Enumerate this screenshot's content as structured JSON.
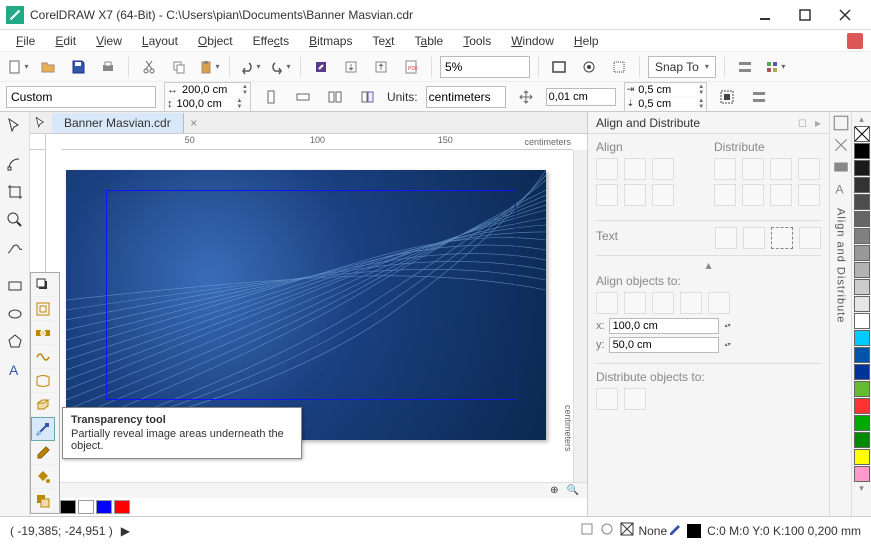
{
  "title": "CorelDRAW X7 (64-Bit) - C:\\Users\\pian\\Documents\\Banner Masvian.cdr",
  "menu": [
    "File",
    "Edit",
    "View",
    "Layout",
    "Object",
    "Effects",
    "Bitmaps",
    "Text",
    "Table",
    "Tools",
    "Window",
    "Help"
  ],
  "zoom_level": "5%",
  "snap_label": "Snap To",
  "preset": "Custom",
  "width": "200,0 cm",
  "height": "100,0 cm",
  "units_label": "Units:",
  "units": "centimeters",
  "nudge": "0,01 cm",
  "dup_x": "0,5 cm",
  "dup_y": "0,5 cm",
  "tab_name": "Banner Masvian.cdr",
  "ruler_unit": "centimeters",
  "ruler_ticks": [
    "50",
    "100",
    "150"
  ],
  "tooltip": {
    "title": "Transparency tool",
    "body": "Partially reveal image areas underneath the object."
  },
  "docker": {
    "title": "Align and Distribute",
    "sect_align": "Align",
    "sect_dist": "Distribute",
    "sect_text": "Text",
    "sect_alignto": "Align objects to:",
    "sect_distto": "Distribute objects to:",
    "x_label": "x:",
    "y_label": "y:",
    "x_val": "100,0 cm",
    "y_val": "50,0 cm",
    "tab_label": "Align and Distribute"
  },
  "palette": [
    "transparent",
    "#000",
    "#111",
    "#222",
    "#333",
    "#444",
    "#555",
    "#666",
    "#777",
    "#888",
    "#999",
    "#aaa",
    "#ccc",
    "#3af",
    "#05f",
    "#f80",
    "#f33",
    "#0a0",
    "#090",
    "#ff0",
    "#f0c"
  ],
  "bottom_colors": [
    "#000",
    "#fff",
    "#00f",
    "#f00"
  ],
  "status": {
    "coords": "( -19,385; -24,951 )",
    "fill": "None",
    "outline": "C:0 M:0 Y:0 K:100  0,200 mm"
  }
}
